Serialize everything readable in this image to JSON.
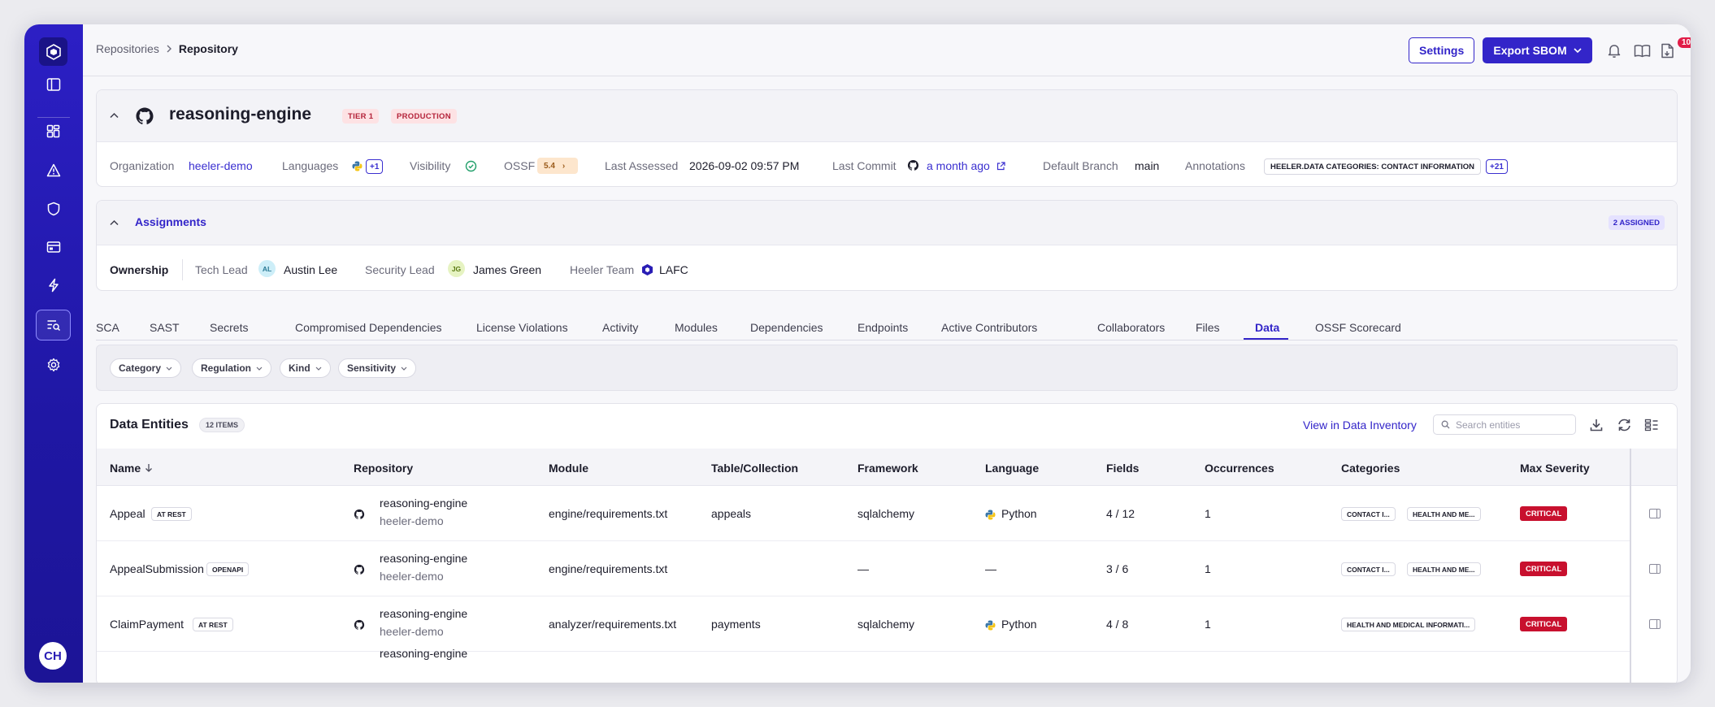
{
  "breadcrumb": {
    "parent": "Repositories",
    "current": "Repository"
  },
  "header": {
    "settings_label": "Settings",
    "export_label": "Export SBOM",
    "notifications_count": "10+"
  },
  "user": {
    "initials": "CH"
  },
  "repo": {
    "name": "reasoning-engine",
    "tags": [
      "TIER 1",
      "PRODUCTION"
    ],
    "meta": {
      "organization_label": "Organization",
      "organization": "heeler-demo",
      "languages_label": "Languages",
      "languages_more": "+1",
      "visibility_label": "Visibility",
      "ossf_label": "OSSF",
      "ossf_score": "5.4",
      "last_assessed_label": "Last Assessed",
      "last_assessed": "2026-09-02 09:57 PM",
      "last_commit_label": "Last Commit",
      "last_commit": "a month ago",
      "default_branch_label": "Default Branch",
      "default_branch": "main",
      "annotations_label": "Annotations",
      "annotation": "HEELER.DATA CATEGORIES: CONTACT INFORMATION",
      "annotations_more": "+21"
    }
  },
  "assignments": {
    "title": "Assignments",
    "badge": "2 ASSIGNED",
    "ownership_label": "Ownership",
    "tech_lead_label": "Tech Lead",
    "tech_lead_initials": "AL",
    "tech_lead": "Austin Lee",
    "security_lead_label": "Security Lead",
    "security_lead_initials": "JG",
    "security_lead": "James Green",
    "team_label": "Heeler Team",
    "team": "LAFC"
  },
  "tabs": [
    "SCA",
    "SAST",
    "Secrets",
    "Compromised Dependencies",
    "License Violations",
    "Activity",
    "Modules",
    "Dependencies",
    "Endpoints",
    "Active Contributors",
    "Collaborators",
    "Files",
    "Data",
    "OSSF Scorecard"
  ],
  "active_tab": "Data",
  "filters": [
    "Category",
    "Regulation",
    "Kind",
    "Sensitivity"
  ],
  "entities": {
    "title": "Data Entities",
    "count": "12 ITEMS",
    "view_link": "View in Data Inventory",
    "search_placeholder": "Search entities",
    "columns": [
      "Name",
      "Repository",
      "Module",
      "Table/Collection",
      "Framework",
      "Language",
      "Fields",
      "Occurrences",
      "Categories",
      "Max Severity"
    ],
    "rows": [
      {
        "name": "Appeal",
        "kind": "AT REST",
        "repo": "reasoning-engine",
        "org": "heeler-demo",
        "module": "engine/requirements.txt",
        "table": "appeals",
        "framework": "sqlalchemy",
        "language": "Python",
        "fields": "4 / 12",
        "occurrences": "1",
        "categories": [
          "CONTACT I...",
          "HEALTH AND ME..."
        ],
        "severity": "CRITICAL"
      },
      {
        "name": "AppealSubmission",
        "kind": "OPENAPI",
        "repo": "reasoning-engine",
        "org": "heeler-demo",
        "module": "engine/requirements.txt",
        "table": "",
        "framework": "—",
        "language": "—",
        "fields": "3 / 6",
        "occurrences": "1",
        "categories": [
          "CONTACT I...",
          "HEALTH AND ME..."
        ],
        "severity": "CRITICAL"
      },
      {
        "name": "ClaimPayment",
        "kind": "AT REST",
        "repo": "reasoning-engine",
        "org": "heeler-demo",
        "module": "analyzer/requirements.txt",
        "table": "payments",
        "framework": "sqlalchemy",
        "language": "Python",
        "fields": "4 / 8",
        "occurrences": "1",
        "categories": [
          "HEALTH AND MEDICAL INFORMATI..."
        ],
        "severity": "CRITICAL"
      }
    ],
    "partial_row_repo": "reasoning-engine"
  },
  "colors": {
    "accent": "#3325c9",
    "sidebar": "#2a1eb5",
    "critical": "#c8102e",
    "tag_red_bg": "#fde2e4"
  },
  "icons": [
    "logo-icon",
    "sidebar-toggle-icon",
    "dashboard-icon",
    "alert-icon",
    "shield-icon",
    "inventory-icon",
    "bolt-icon",
    "search-code-icon",
    "gear-icon",
    "bell-icon",
    "book-icon",
    "document-icon",
    "github-icon",
    "python-icon",
    "download-icon",
    "refresh-icon",
    "columns-icon",
    "panel-icon"
  ]
}
